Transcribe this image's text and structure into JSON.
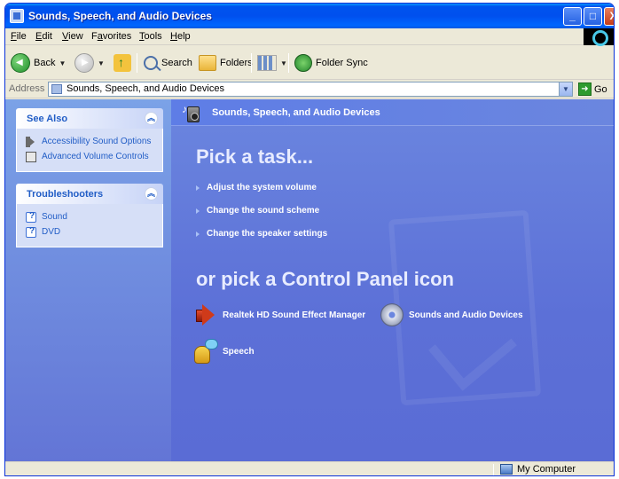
{
  "window": {
    "title": "Sounds, Speech, and Audio Devices",
    "buttons": {
      "minimize": "_",
      "maximize": "□",
      "close": "X"
    }
  },
  "menubar": {
    "items": [
      {
        "label": "File",
        "key": "F",
        "rest": "ile"
      },
      {
        "label": "Edit",
        "key": "E",
        "rest": "dit"
      },
      {
        "label": "View",
        "key": "V",
        "rest": "iew"
      },
      {
        "label": "Favorites",
        "key": "a",
        "pre": "F",
        "rest": "vorites"
      },
      {
        "label": "Tools",
        "key": "T",
        "rest": "ools"
      },
      {
        "label": "Help",
        "key": "H",
        "rest": "elp"
      }
    ]
  },
  "toolbar": {
    "back": "Back",
    "search": "Search",
    "folders": "Folders",
    "folder_sync": "Folder Sync"
  },
  "address": {
    "label": "Address",
    "value": "Sounds, Speech, and Audio Devices",
    "go": "Go"
  },
  "sidebar": {
    "see_also": {
      "title": "See Also",
      "links": [
        "Accessibility Sound Options",
        "Advanced Volume Controls"
      ]
    },
    "troubleshooters": {
      "title": "Troubleshooters",
      "links": [
        "Sound",
        "DVD"
      ]
    }
  },
  "main": {
    "header": "Sounds, Speech, and Audio Devices",
    "pick_task": "Pick a task...",
    "tasks": [
      "Adjust the system volume",
      "Change the sound scheme",
      "Change the speaker settings"
    ],
    "pick_icon": "or pick a Control Panel icon",
    "icons": [
      {
        "label": "Realtek HD Sound Effect Manager",
        "icon": "speaker-icon"
      },
      {
        "label": "Sounds and Audio Devices",
        "icon": "cd-icon"
      },
      {
        "label": "Speech",
        "icon": "speech-icon"
      }
    ]
  },
  "status": {
    "zone": "My Computer"
  }
}
